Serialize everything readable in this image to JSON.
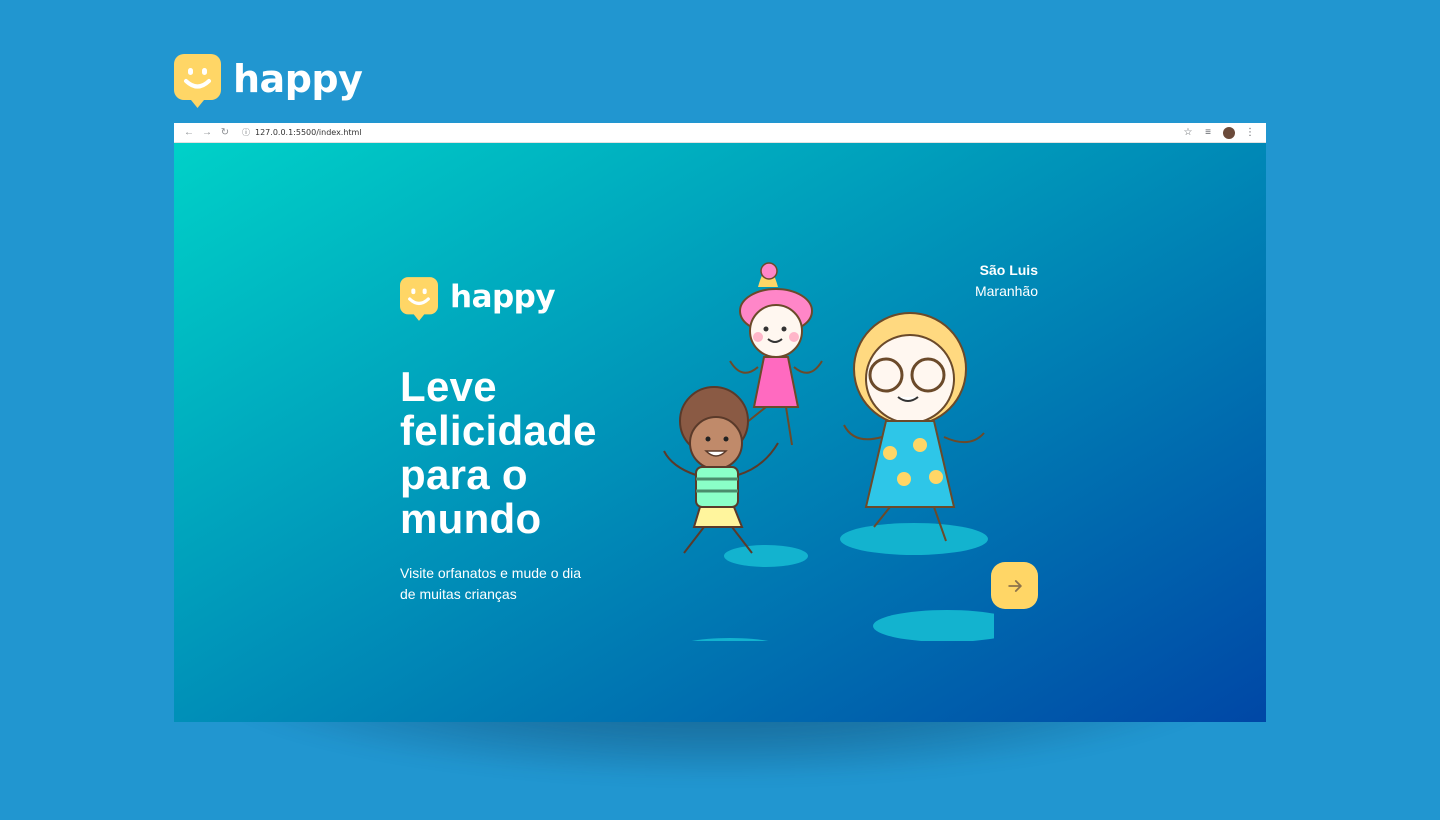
{
  "brand": {
    "name": "happy",
    "logo_icon": "smiley-chat-bubble-icon",
    "logo_color": "#ffd666"
  },
  "browser": {
    "url": "127.0.0.1:5500/index.html",
    "back_icon": "arrow-left-icon",
    "forward_icon": "arrow-right-icon",
    "reload_icon": "reload-icon",
    "bookmark_icon": "star-icon",
    "menu_icon": "kebab-menu-icon"
  },
  "page": {
    "brand": "happy",
    "location": {
      "city": "São Luis",
      "state": "Maranhão"
    },
    "headline": "Leve felicidade para o mundo",
    "subline": "Visite orfanatos e mude o dia de muitas crianças",
    "enter_icon": "arrow-right-icon",
    "gradient": [
      "#00d1c8",
      "#0047a6"
    ]
  },
  "colors": {
    "background": "#2196d0",
    "accent": "#ffd666"
  }
}
